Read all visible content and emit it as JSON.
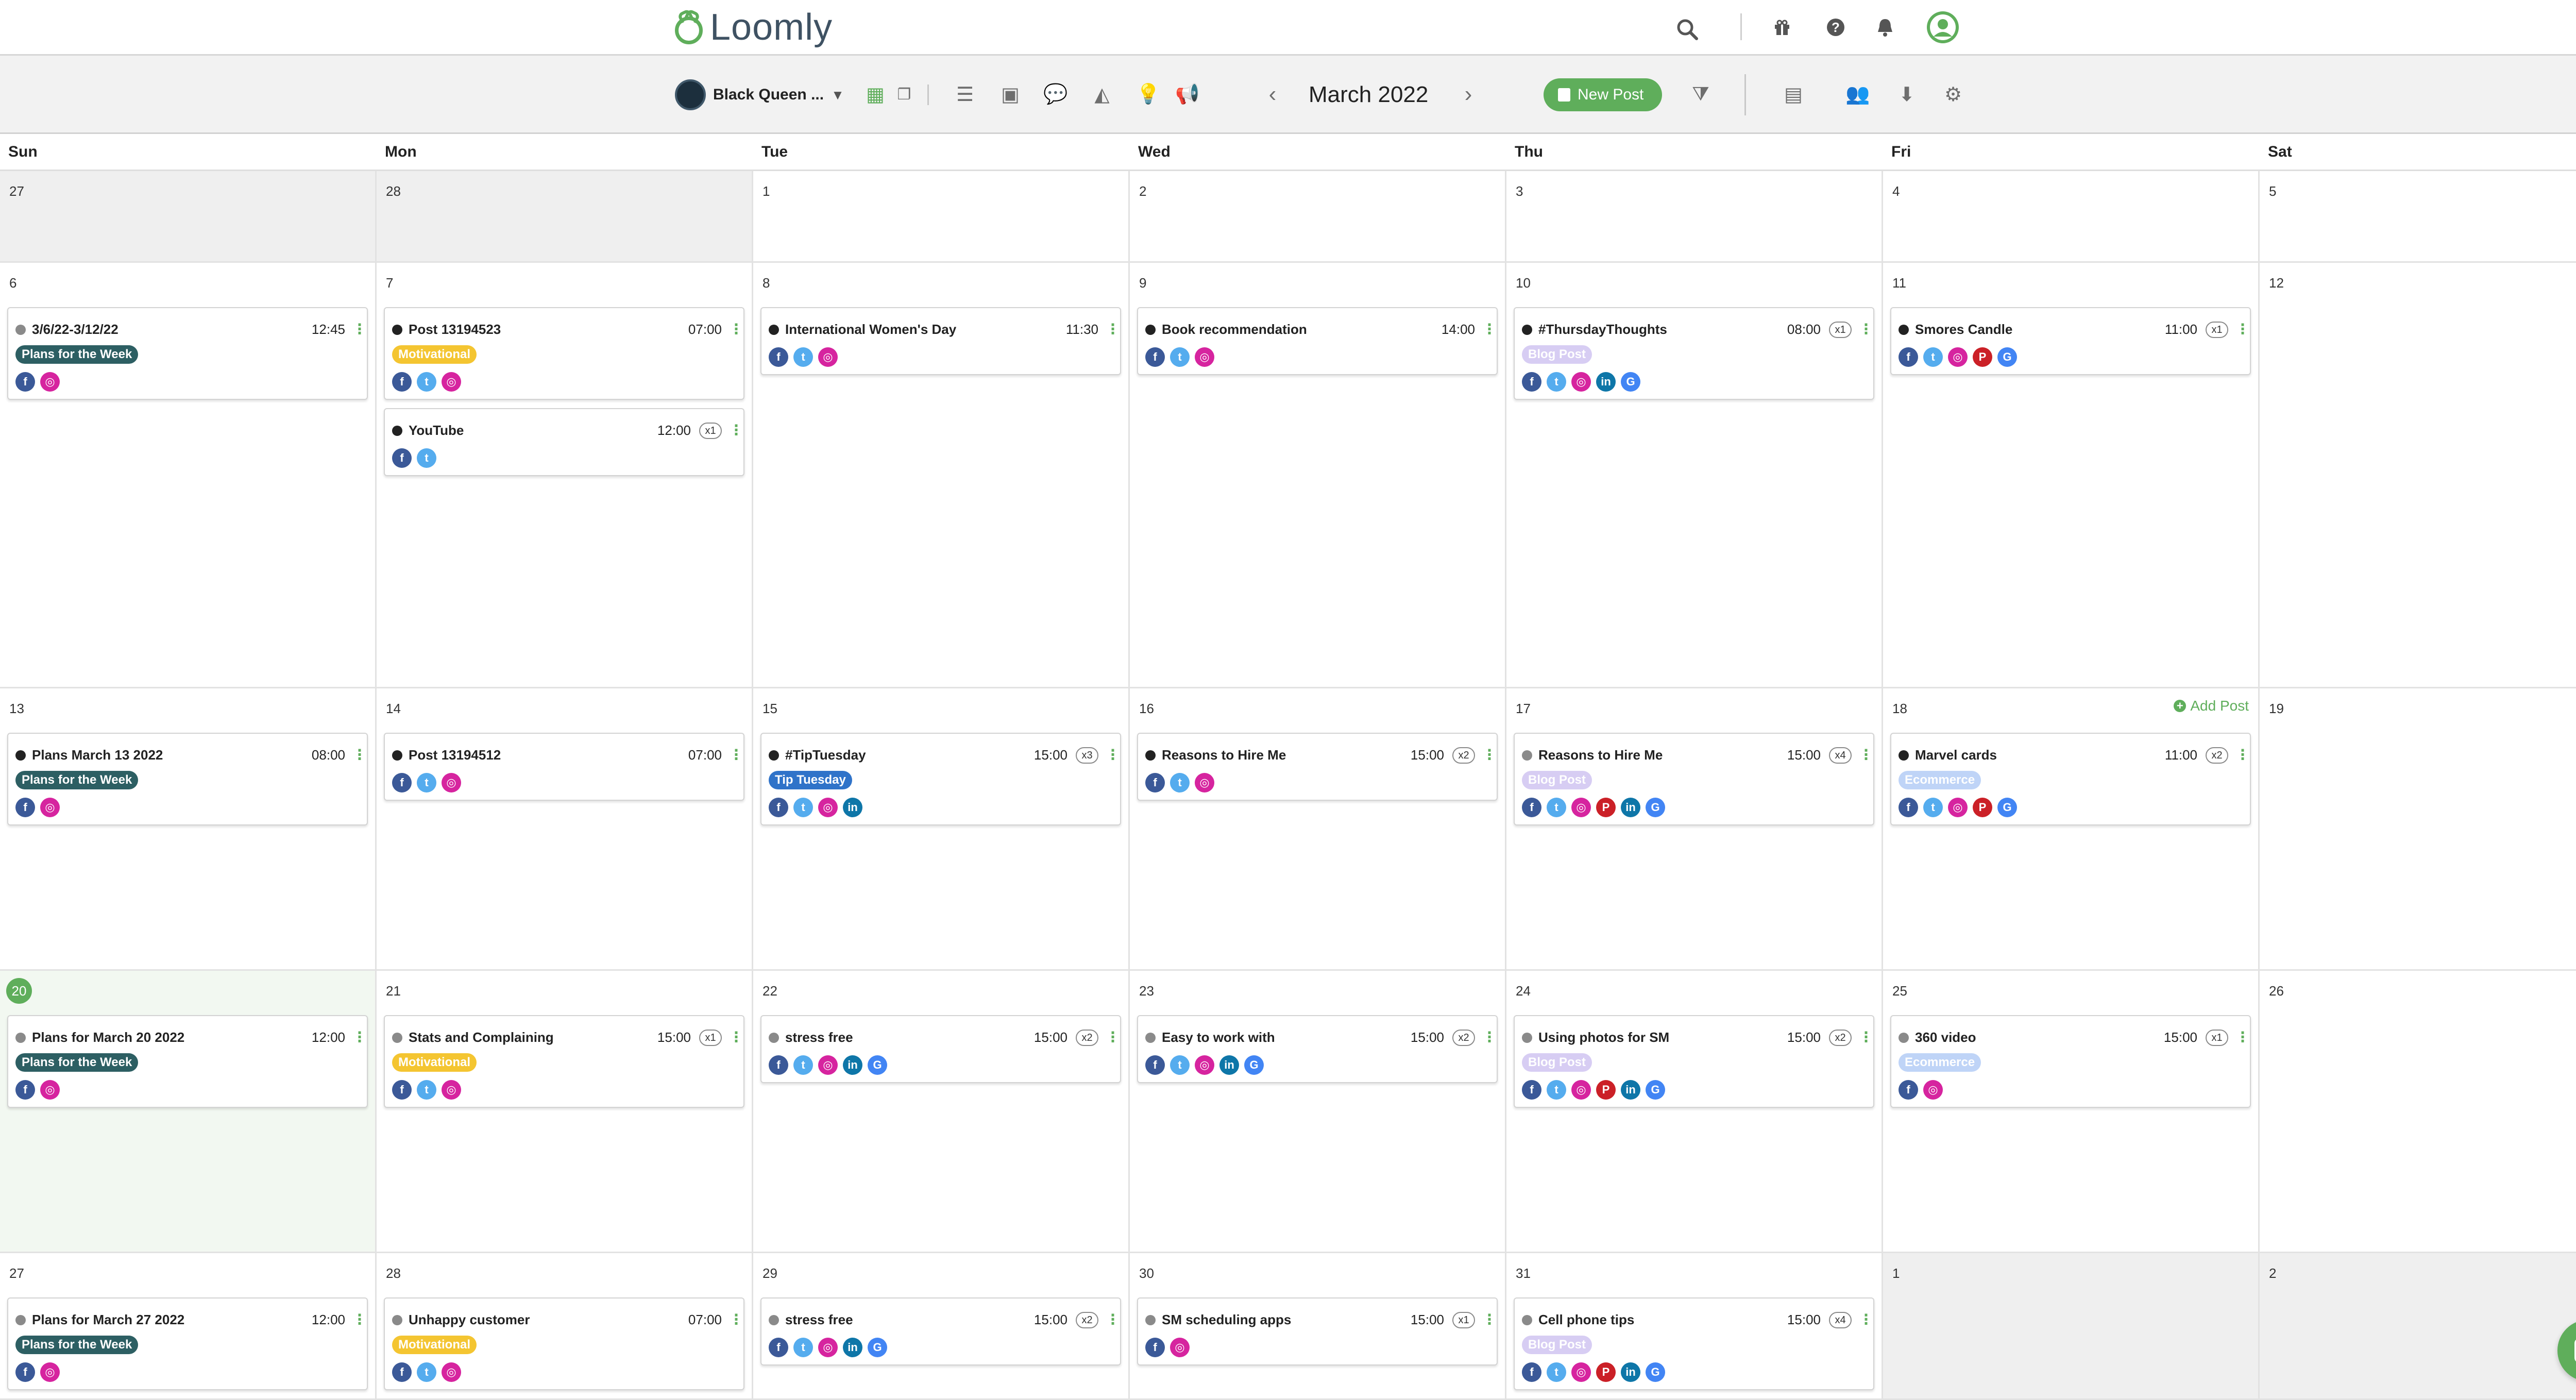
{
  "app": {
    "name": "Loomly"
  },
  "colors": {
    "accent": "#5fae5b",
    "status": {
      "dark": "#222222",
      "grey": "#8a8a8a",
      "teal": "#5c8a8a"
    },
    "networks": {
      "facebook": "#3b5998",
      "twitter": "#55acee",
      "instagram": "#d6249f",
      "pinterest": "#cb2027",
      "linkedin": "#0e76a8",
      "google": "#4285f4"
    }
  },
  "header": {
    "icons": [
      "search-icon",
      "gift-icon",
      "help-icon",
      "bell-icon",
      "user-avatar-icon"
    ]
  },
  "toolbar": {
    "brand_name": "Black Queen ...",
    "month": "March 2022",
    "new_post_label": "New Post",
    "view_icons": [
      "calendar-icon",
      "copy-icon",
      "list-icon",
      "image-icon",
      "chat-bubbles-icon",
      "analytics-icon",
      "lightbulb-icon",
      "megaphone-icon"
    ],
    "right_icons": [
      "filter-icon",
      "library-icon",
      "team-icon",
      "download-icon",
      "settings-icon"
    ]
  },
  "labels": {
    "plans": {
      "text": "Plans for the Week",
      "bg": "#2d5f63",
      "fg": "#ffffff"
    },
    "motivational": {
      "text": "Motivational",
      "bg": "#f4c531",
      "fg": "#ffffff"
    },
    "blog": {
      "text": "Blog Post",
      "bg": "#d7cdf3",
      "fg": "#ffffff"
    },
    "tip": {
      "text": "Tip Tuesday",
      "bg": "#2f73c9",
      "fg": "#ffffff"
    },
    "ecommerce": {
      "text": "Ecommerce",
      "bg": "#bfd4f7",
      "fg": "#ffffff"
    }
  },
  "calendar": {
    "weekdays": [
      "Sun",
      "Mon",
      "Tue",
      "Wed",
      "Thu",
      "Fri",
      "Sat"
    ],
    "add_post_label": "Add Post",
    "weeks": [
      {
        "days": [
          {
            "num": "27",
            "out": true,
            "posts": []
          },
          {
            "num": "28",
            "out": true,
            "posts": []
          },
          {
            "num": "1",
            "posts": []
          },
          {
            "num": "2",
            "posts": []
          },
          {
            "num": "3",
            "posts": []
          },
          {
            "num": "4",
            "posts": []
          },
          {
            "num": "5",
            "posts": []
          }
        ]
      },
      {
        "days": [
          {
            "num": "6",
            "posts": [
              {
                "title": "3/6/22-3/12/22",
                "time": "12:45",
                "status": "grey",
                "label": "plans",
                "networks": [
                  "f",
                  "i"
                ]
              }
            ]
          },
          {
            "num": "7",
            "posts": [
              {
                "title": "Post 13194523",
                "time": "07:00",
                "status": "dark",
                "label": "motivational",
                "networks": [
                  "f",
                  "t",
                  "i"
                ]
              },
              {
                "title": "YouTube",
                "time": "12:00",
                "count": "x1",
                "status": "dark",
                "networks": [
                  "f",
                  "t"
                ]
              }
            ]
          },
          {
            "num": "8",
            "posts": [
              {
                "title": "International Women's Day",
                "time": "11:30",
                "status": "dark",
                "networks": [
                  "f",
                  "t",
                  "i"
                ]
              }
            ]
          },
          {
            "num": "9",
            "posts": [
              {
                "title": "Book recommendation",
                "time": "14:00",
                "status": "dark",
                "networks": [
                  "f",
                  "t",
                  "i"
                ]
              }
            ]
          },
          {
            "num": "10",
            "posts": [
              {
                "title": "#ThursdayThoughts",
                "time": "08:00",
                "count": "x1",
                "status": "dark",
                "label": "blog",
                "networks": [
                  "f",
                  "t",
                  "i",
                  "in",
                  "g"
                ]
              }
            ]
          },
          {
            "num": "11",
            "posts": [
              {
                "title": "Smores Candle",
                "time": "11:00",
                "count": "x1",
                "status": "dark",
                "networks": [
                  "f",
                  "t",
                  "i",
                  "p",
                  "g"
                ]
              }
            ]
          },
          {
            "num": "12",
            "posts": []
          }
        ]
      },
      {
        "days": [
          {
            "num": "13",
            "posts": [
              {
                "title": "Plans March 13 2022",
                "time": "08:00",
                "status": "dark",
                "label": "plans",
                "networks": [
                  "f",
                  "i"
                ]
              }
            ]
          },
          {
            "num": "14",
            "posts": [
              {
                "title": "Post 13194512",
                "time": "07:00",
                "status": "dark",
                "networks": [
                  "f",
                  "t",
                  "i"
                ]
              }
            ]
          },
          {
            "num": "15",
            "posts": [
              {
                "title": "#TipTuesday",
                "time": "15:00",
                "count": "x3",
                "status": "dark",
                "label": "tip",
                "networks": [
                  "f",
                  "t",
                  "i",
                  "in"
                ]
              }
            ]
          },
          {
            "num": "16",
            "posts": [
              {
                "title": "Reasons to Hire Me",
                "time": "15:00",
                "count": "x2",
                "status": "dark",
                "networks": [
                  "f",
                  "t",
                  "i"
                ]
              }
            ]
          },
          {
            "num": "17",
            "posts": [
              {
                "title": "Reasons to Hire Me",
                "time": "15:00",
                "count": "x4",
                "status": "grey",
                "label": "blog",
                "networks": [
                  "f",
                  "t",
                  "i",
                  "p",
                  "in",
                  "g"
                ]
              }
            ]
          },
          {
            "num": "18",
            "add": true,
            "posts": [
              {
                "title": "Marvel cards",
                "time": "11:00",
                "count": "x2",
                "status": "dark",
                "label": "ecommerce",
                "networks": [
                  "f",
                  "t",
                  "i",
                  "p",
                  "g"
                ]
              }
            ]
          },
          {
            "num": "19",
            "posts": []
          }
        ]
      },
      {
        "days": [
          {
            "num": "20",
            "today": true,
            "posts": [
              {
                "title": "Plans for March 20 2022",
                "time": "12:00",
                "status": "grey",
                "label": "plans",
                "networks": [
                  "f",
                  "i"
                ]
              }
            ]
          },
          {
            "num": "21",
            "posts": [
              {
                "title": "Stats and Complaining",
                "time": "15:00",
                "count": "x1",
                "status": "grey",
                "label": "motivational",
                "networks": [
                  "f",
                  "t",
                  "i"
                ]
              }
            ]
          },
          {
            "num": "22",
            "posts": [
              {
                "title": "stress free",
                "time": "15:00",
                "count": "x2",
                "status": "grey",
                "networks": [
                  "f",
                  "t",
                  "i",
                  "in",
                  "g"
                ]
              }
            ]
          },
          {
            "num": "23",
            "posts": [
              {
                "title": "Easy to work with",
                "time": "15:00",
                "count": "x2",
                "status": "grey",
                "networks": [
                  "f",
                  "t",
                  "i",
                  "in",
                  "g"
                ]
              }
            ]
          },
          {
            "num": "24",
            "posts": [
              {
                "title": "Using photos for SM",
                "time": "15:00",
                "count": "x2",
                "status": "grey",
                "label": "blog",
                "networks": [
                  "f",
                  "t",
                  "i",
                  "p",
                  "in",
                  "g"
                ]
              }
            ]
          },
          {
            "num": "25",
            "posts": [
              {
                "title": "360 video",
                "time": "15:00",
                "count": "x1",
                "status": "grey",
                "label": "ecommerce",
                "networks": [
                  "f",
                  "i"
                ]
              }
            ]
          },
          {
            "num": "26",
            "posts": []
          }
        ]
      },
      {
        "days": [
          {
            "num": "27",
            "posts": [
              {
                "title": "Plans for March 27 2022",
                "time": "12:00",
                "status": "grey",
                "label": "plans",
                "networks": [
                  "f",
                  "i"
                ]
              }
            ]
          },
          {
            "num": "28",
            "posts": [
              {
                "title": "Unhappy customer",
                "time": "07:00",
                "status": "grey",
                "label": "motivational",
                "networks": [
                  "f",
                  "t",
                  "i"
                ]
              }
            ]
          },
          {
            "num": "29",
            "posts": [
              {
                "title": "stress free",
                "time": "15:00",
                "count": "x2",
                "status": "grey",
                "networks": [
                  "f",
                  "t",
                  "i",
                  "in",
                  "g"
                ]
              }
            ]
          },
          {
            "num": "30",
            "posts": [
              {
                "title": "SM scheduling apps",
                "time": "15:00",
                "count": "x1",
                "status": "grey",
                "networks": [
                  "f",
                  "i"
                ]
              }
            ]
          },
          {
            "num": "31",
            "posts": [
              {
                "title": "Cell phone tips",
                "time": "15:00",
                "count": "x4",
                "status": "grey",
                "label": "blog",
                "networks": [
                  "f",
                  "t",
                  "i",
                  "p",
                  "in",
                  "g"
                ]
              }
            ]
          },
          {
            "num": "1",
            "out": true,
            "posts": []
          },
          {
            "num": "2",
            "out": true,
            "posts": []
          }
        ]
      }
    ]
  }
}
